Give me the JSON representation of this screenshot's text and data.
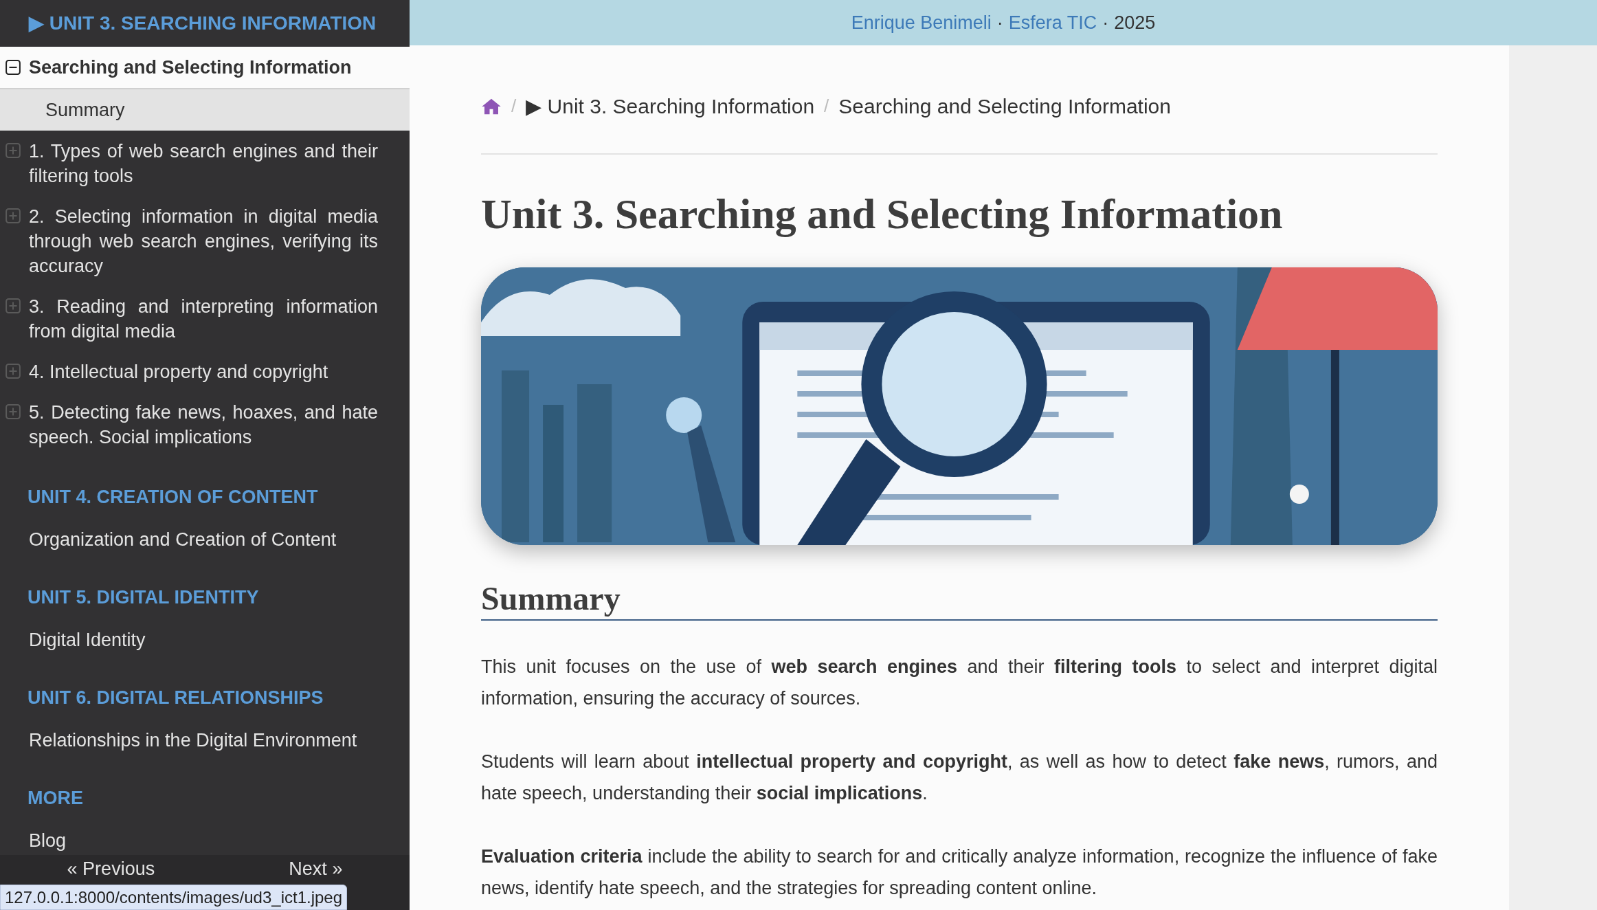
{
  "header": {
    "credits": [
      {
        "kind": "link",
        "text": "Enrique Benimeli"
      },
      {
        "kind": "text",
        "text": "·"
      },
      {
        "kind": "link",
        "text": "Esfera TIC"
      },
      {
        "kind": "text",
        "text": "·"
      },
      {
        "kind": "text",
        "text": "2025"
      }
    ]
  },
  "sidebar": {
    "current_unit": "▶ UNIT 3. SEARCHING INFORMATION",
    "page": {
      "label": "Searching and Selecting Information",
      "expanded": true
    },
    "items": [
      {
        "kind": "page",
        "label": "Summary",
        "selected": true
      },
      {
        "kind": "section",
        "label": "1. Types of web search engines and their filtering tools",
        "selected": false,
        "expanded": false
      },
      {
        "kind": "section",
        "label": "2. Selecting information in digital media through web search engines, verifying its accuracy",
        "selected": false,
        "expanded": false
      },
      {
        "kind": "section",
        "label": "3. Reading and interpreting information from digital media",
        "selected": false,
        "expanded": false
      },
      {
        "kind": "section",
        "label": "4. Intellectual property and copyright",
        "selected": false,
        "expanded": false
      },
      {
        "kind": "section",
        "label": "5. Detecting fake news, hoaxes, and hate speech. Social implications",
        "selected": false,
        "expanded": false
      }
    ],
    "sections": [
      {
        "title": "UNIT 4. CREATION OF CONTENT",
        "items": [
          "Organization and Creation of Content"
        ]
      },
      {
        "title": "UNIT 5. DIGITAL IDENTITY",
        "items": [
          "Digital Identity"
        ]
      },
      {
        "title": "UNIT 6. DIGITAL RELATIONSHIPS",
        "items": [
          "Relationships in the Digital Environment"
        ]
      },
      {
        "title": "MORE",
        "items": [
          "Blog"
        ]
      }
    ],
    "pager": {
      "previous": "« Previous",
      "next": "Next »"
    }
  },
  "status_url": "127.0.0.1:8000/contents/images/ud3_ict1.jpeg",
  "breadcrumb": [
    {
      "kind": "home"
    },
    {
      "kind": "separator",
      "text": "/"
    },
    {
      "kind": "link",
      "text": "▶ Unit 3. Searching Information"
    },
    {
      "kind": "separator",
      "text": "/"
    },
    {
      "kind": "current",
      "text": "Searching and Selecting Information"
    }
  ],
  "content": {
    "title": "Unit 3. Searching and Selecting Information",
    "summary_heading": "Summary",
    "paragraphs": [
      "This unit focuses on the use of **web search engines** and their **filtering tools** to select and interpret digital information, ensuring the accuracy of sources.",
      "Students will learn about **intellectual property and copyright**, as well as how to detect **fake news**, rumors, and hate speech, understanding their **social implications**.",
      "**Evaluation criteria** include the ability to search for and critically analyze information, recognize the influence of fake news, identify hate speech, and the strategies for spreading content online."
    ]
  }
}
